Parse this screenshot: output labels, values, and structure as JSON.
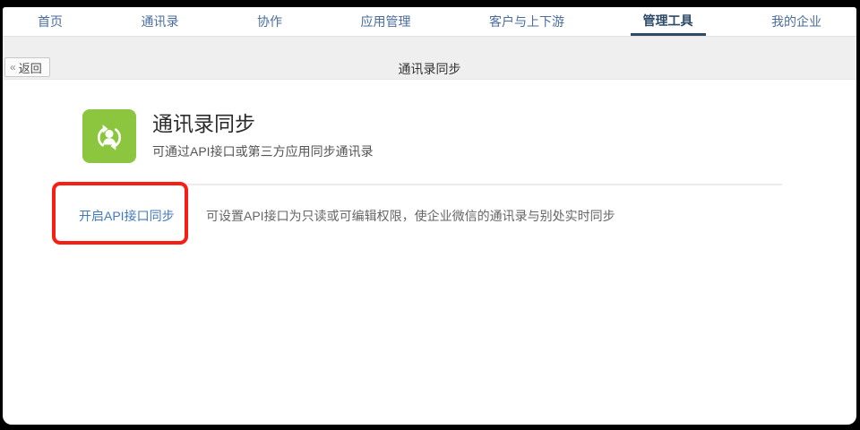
{
  "nav": {
    "items": [
      {
        "label": "首页",
        "active": false
      },
      {
        "label": "通讯录",
        "active": false
      },
      {
        "label": "协作",
        "active": false
      },
      {
        "label": "应用管理",
        "active": false
      },
      {
        "label": "客户与上下游",
        "active": false
      },
      {
        "label": "管理工具",
        "active": true
      },
      {
        "label": "我的企业",
        "active": false
      }
    ]
  },
  "subheader": {
    "back_icon": "«",
    "back_label": "返回",
    "title": "通讯录同步"
  },
  "app": {
    "icon": "contact-sync-icon",
    "title": "通讯录同步",
    "description": "可通过API接口或第三方应用同步通讯录"
  },
  "settings": {
    "link_label": "开启API接口同步",
    "description": "可设置API接口为只读或可编辑权限，使企业微信的通讯录与别处实时同步"
  },
  "colors": {
    "nav_link": "#4a6d9b",
    "nav_active": "#2d4a68",
    "app_icon_green": "#8bc63e",
    "link_blue": "#4379b8",
    "annotation_red": "#f71e14",
    "subbar_gray": "#efefef"
  }
}
